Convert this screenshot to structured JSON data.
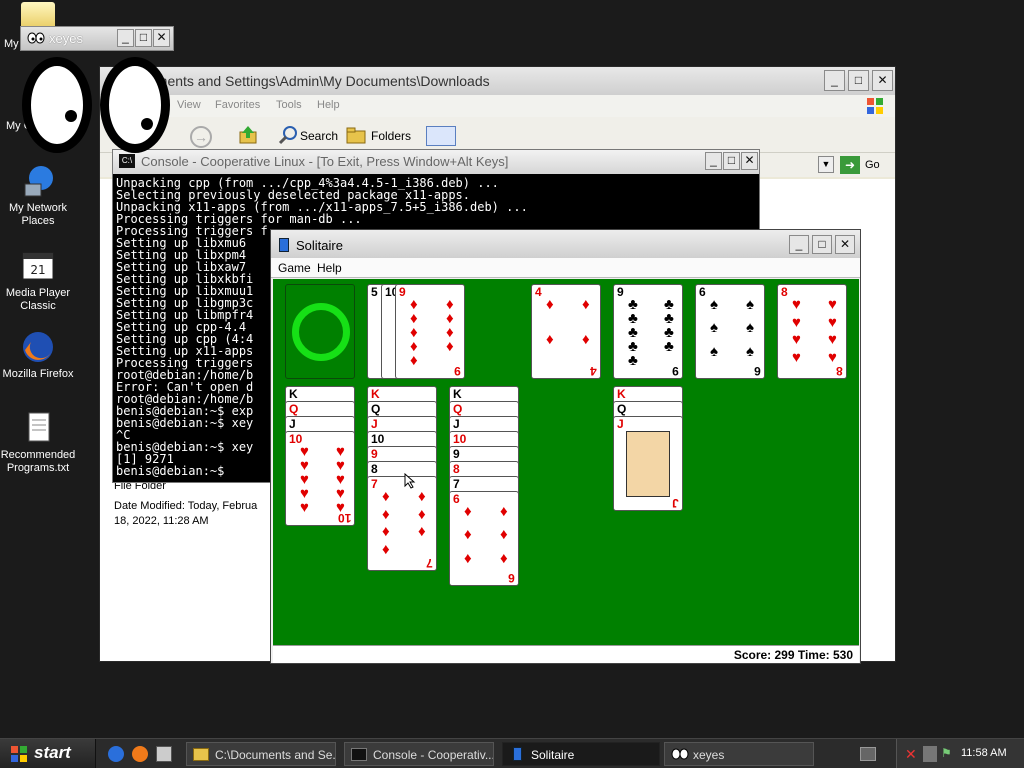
{
  "desktop": {
    "icons": [
      {
        "label": "My Network Places",
        "icon": "network-icon"
      },
      {
        "label": "Media Player Classic",
        "icon": "media-player-icon"
      },
      {
        "label": "Mozilla Firefox",
        "icon": "firefox-icon"
      },
      {
        "label": "Recommended Programs.txt",
        "icon": "text-file-icon"
      }
    ],
    "partial_labels": [
      "My",
      "My C"
    ]
  },
  "explorer": {
    "title": "uments and Settings\\Admin\\My Documents\\Downloads",
    "menu": [
      "View",
      "Favorites",
      "Tools",
      "Help"
    ],
    "toolbar": {
      "search": "Search",
      "folders": "Folders"
    },
    "go_label": "Go",
    "details": {
      "type": "File Folder",
      "modified": "Date Modified: Today, Februa",
      "modified2": "18, 2022, 11:28 AM"
    }
  },
  "console": {
    "title": "Console - Cooperative Linux - [To Exit, Press Window+Alt Keys]",
    "lines": [
      "Unpacking cpp (from .../cpp_4%3a4.4.5-1_i386.deb) ...",
      "Selecting previously deselected package x11-apps.",
      "Unpacking x11-apps (from .../x11-apps_7.5+5_i386.deb) ...",
      "Processing triggers for man-db ...",
      "Processing triggers f",
      "Setting up libxmu6",
      "Setting up libxpm4",
      "Setting up libxaw7",
      "Setting up libxkbfi",
      "Setting up libxmuu1",
      "Setting up libgmp3c",
      "Setting up libmpfr4",
      "Setting up cpp-4.4",
      "Setting up cpp (4:4",
      "Setting up x11-apps",
      "Processing triggers",
      "root@debian:/home/b",
      "Error: Can't open d",
      "root@debian:/home/b",
      "benis@debian:~$ exp",
      "benis@debian:~$ xey",
      "^C",
      "benis@debian:~$ xey",
      "[1] 9271",
      "benis@debian:~$"
    ]
  },
  "xeyes": {
    "title": "xeyes"
  },
  "solitaire": {
    "title": "Solitaire",
    "menu": [
      "Game",
      "Help"
    ],
    "status": "Score: 299 Time: 530",
    "foundations": [
      {
        "rank": "4",
        "suit": "♦",
        "color": "red"
      },
      {
        "rank": "9",
        "suit": "♣",
        "color": "black"
      },
      {
        "rank": "6",
        "suit": "♠",
        "color": "black"
      },
      {
        "rank": "8",
        "suit": "♥",
        "color": "red"
      }
    ],
    "waste": [
      {
        "rank": "5",
        "suit": "♠",
        "color": "black"
      },
      {
        "rank": "10",
        "suit": "♠",
        "color": "black"
      },
      {
        "rank": "9",
        "suit": "♦",
        "color": "red"
      }
    ],
    "tableau": [
      [
        {
          "rank": "K",
          "color": "black"
        },
        {
          "rank": "Q",
          "color": "red"
        },
        {
          "rank": "J",
          "color": "black"
        },
        {
          "rank": "10",
          "suit": "♥",
          "color": "red"
        }
      ],
      [
        {
          "rank": "K",
          "color": "red"
        },
        {
          "rank": "Q",
          "color": "black"
        },
        {
          "rank": "J",
          "color": "red"
        },
        {
          "rank": "10",
          "color": "black"
        },
        {
          "rank": "9",
          "color": "red"
        },
        {
          "rank": "8",
          "color": "black"
        },
        {
          "rank": "7",
          "suit": "♦",
          "color": "red"
        }
      ],
      [
        {
          "rank": "K",
          "color": "black"
        },
        {
          "rank": "Q",
          "color": "red"
        },
        {
          "rank": "J",
          "color": "black"
        },
        {
          "rank": "10",
          "color": "red"
        },
        {
          "rank": "9",
          "color": "black"
        },
        {
          "rank": "8",
          "color": "red"
        },
        {
          "rank": "7",
          "color": "black"
        },
        {
          "rank": "6",
          "suit": "♦",
          "color": "red"
        }
      ],
      [
        {
          "rank": "K",
          "color": "red"
        },
        {
          "rank": "Q",
          "color": "black"
        },
        {
          "rank": "J",
          "suit": "♦",
          "color": "red"
        }
      ]
    ]
  },
  "taskbar": {
    "start_label": "start",
    "tasks": [
      {
        "label": "C:\\Documents and Se..."
      },
      {
        "label": "Console - Cooperativ..."
      },
      {
        "label": "Solitaire"
      },
      {
        "label": "xeyes"
      }
    ],
    "clock": "11:58 AM"
  }
}
